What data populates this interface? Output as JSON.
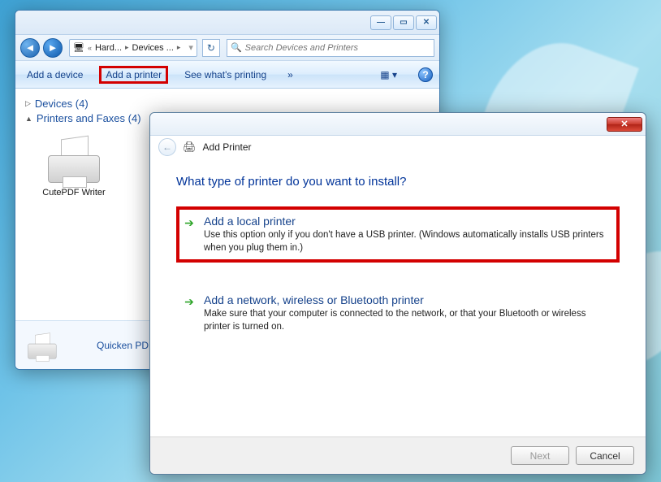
{
  "explorer": {
    "breadcrumb": {
      "seg1": "Hard...",
      "seg2": "Devices ..."
    },
    "search_placeholder": "Search Devices and Printers",
    "toolbar": {
      "add_device": "Add a device",
      "add_printer": "Add a printer",
      "see_printing": "See what's printing",
      "more": "»"
    },
    "tree": {
      "devices_label": "Devices (4)",
      "printers_label": "Printers and Faxes (4)"
    },
    "items": {
      "cutepdf": "CutePDF Writer"
    },
    "status_label": "Quicken PD"
  },
  "wizard": {
    "title": "Add Printer",
    "question": "What type of printer do you want to install?",
    "opt_local": {
      "title": "Add a local printer",
      "desc": "Use this option only if you don't have a USB printer. (Windows automatically installs USB printers when you plug them in.)"
    },
    "opt_network": {
      "title": "Add a network, wireless or Bluetooth printer",
      "desc": "Make sure that your computer is connected to the network, or that your Bluetooth or wireless printer is turned on."
    },
    "buttons": {
      "next": "Next",
      "cancel": "Cancel"
    }
  }
}
